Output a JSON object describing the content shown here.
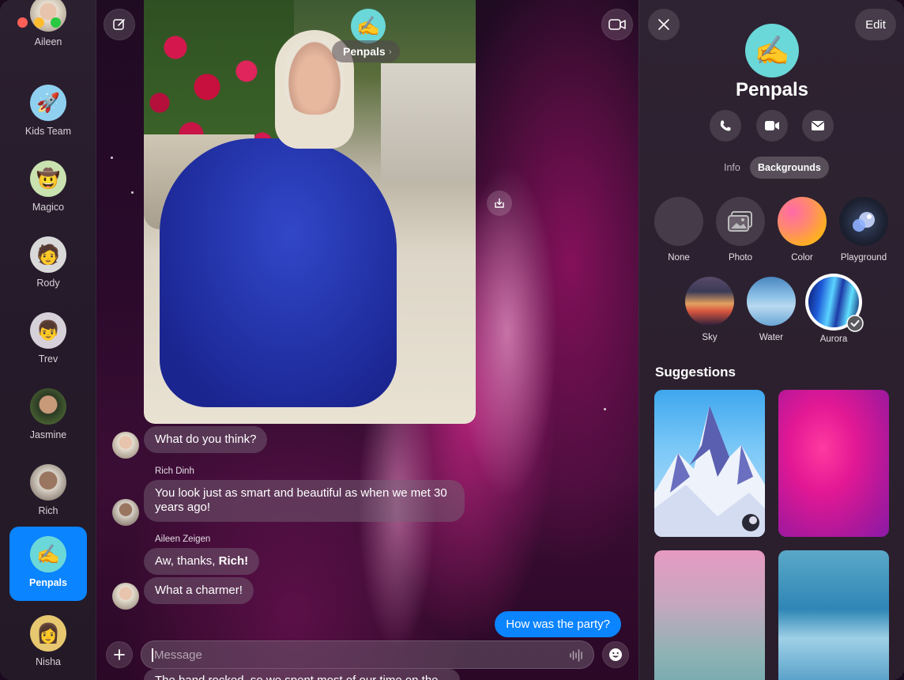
{
  "sidebar": {
    "contacts": [
      {
        "name": "Aileen",
        "emoji": ""
      },
      {
        "name": "Kids Team",
        "emoji": "🚀"
      },
      {
        "name": "Magico",
        "emoji": "🤠"
      },
      {
        "name": "Rody",
        "emoji": "🧑"
      },
      {
        "name": "Trev",
        "emoji": "👦"
      },
      {
        "name": "Jasmine",
        "emoji": "👩"
      },
      {
        "name": "Rich",
        "emoji": "👴"
      },
      {
        "name": "Penpals",
        "emoji": "✍️",
        "active": true
      },
      {
        "name": "Nisha",
        "emoji": "👩"
      }
    ]
  },
  "conversation": {
    "title": "Penpals",
    "title_chevron": "›",
    "group_emoji": "✍️",
    "messages": [
      {
        "text": "What do you think?"
      },
      {
        "sender": "Rich Dinh",
        "text": "You look just as smart and beautiful as when we met 30 years ago!"
      },
      {
        "sender": "Aileen Zeigen",
        "text_pre": "Aw, thanks, ",
        "text_bold": "Rich!"
      },
      {
        "text": "What a charmer!"
      }
    ],
    "outgoing": "How was the party?",
    "composer_placeholder": "Message",
    "peek_text": "The band rocked, so we spent most of our time on the"
  },
  "panel": {
    "edit_label": "Edit",
    "group_emoji": "✍️",
    "title": "Penpals",
    "tabs": [
      "Info",
      "Backgrounds"
    ],
    "active_tab": "Backgrounds",
    "backgrounds": [
      "None",
      "Photo",
      "Color",
      "Playground",
      "Sky",
      "Water",
      "Aurora"
    ],
    "selected_background": "Aurora",
    "suggestions_title": "Suggestions"
  }
}
